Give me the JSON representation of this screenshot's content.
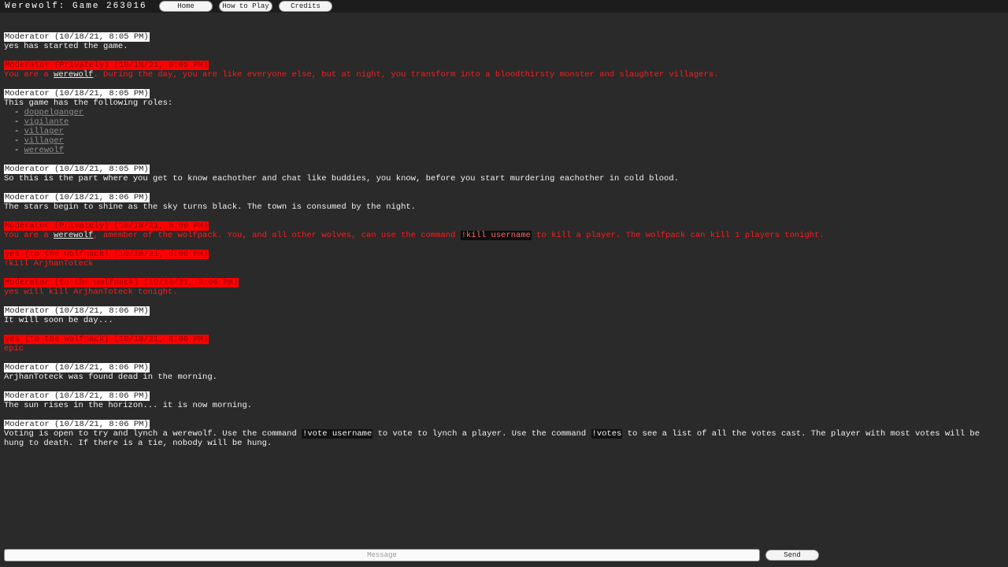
{
  "header": {
    "title": "Werewolf: Game 263016",
    "nav": {
      "home": "Home",
      "how_to_play": "How to Play",
      "credits": "Credits"
    }
  },
  "messages": [
    {
      "header": "Moderator (10/18/21, 8:05 PM)",
      "text": "yes has started the game."
    },
    {
      "header": "Moderator (Privately) (10/18/21, 8:05 PM)",
      "pre": "You are a ",
      "link": "werewolf",
      "post": ". During the day, you are like everyone else, but at night, you transform into a bloodthirsty monster and slaughter villagers."
    },
    {
      "header": "Moderator (10/18/21, 8:05 PM)",
      "text": "This game has the following roles:",
      "roles": [
        "doppelganger",
        "vigilante",
        "villager",
        "villager",
        "werewolf"
      ]
    },
    {
      "header": "Moderator (10/18/21, 8:05 PM)",
      "text": "So this is the part where you get to know eachother and chat like buddies, you know, before you start murdering eachother in cold blood."
    },
    {
      "header": "Moderator (10/18/21, 8:06 PM)",
      "text": "The stars begin to shine as the sky turns black. The town is consumed by the night."
    },
    {
      "header": "Moderator (Privately) (10/18/21, 8:06 PM)",
      "pre": "You are a ",
      "link": "werewolf",
      "mid": ", amember of the wolfpack. You, and all other wolves, can use the command ",
      "cmd": "!kill username",
      "post": " to kill a player. The wolfpack can kill 1 players tonight."
    },
    {
      "header": "yes (to the wolfpack) (10/18/21, 8:06 PM)",
      "text": "!kill ArjhanToteck"
    },
    {
      "header": "Moderator (to the wolfpack) (10/18/21, 8:06 PM)",
      "text": "yes will kill ArjhanToteck tonight."
    },
    {
      "header": "Moderator (10/18/21, 8:06 PM)",
      "text": "It will soon be day..."
    },
    {
      "header": "yes (to the wolfpack) (10/18/21, 8:06 PM)",
      "text": "epic"
    },
    {
      "header": "Moderator (10/18/21, 8:06 PM)",
      "text": "ArjhanToteck was found dead in the morning."
    },
    {
      "header": "Moderator (10/18/21, 8:06 PM)",
      "text": "The sun rises in the horizon... it is now morning."
    },
    {
      "header": "Moderator (10/18/21, 8:06 PM)",
      "pre": "Voting is open to try and lynch a werewolf. Use the command ",
      "cmd": "!vote username",
      "mid": " to vote to lynch a player. Use the command ",
      "cmd2": "!votes",
      "post": " to see a list of all the votes cast. The player with most votes will be hung to death. If there is a tie, nobody will be hung."
    }
  ],
  "input": {
    "placeholder": "Message",
    "send_label": "Send"
  },
  "colors": {
    "background": "#2a2a2a",
    "private_red": "#ff0000",
    "header_white": "#ffffff"
  }
}
